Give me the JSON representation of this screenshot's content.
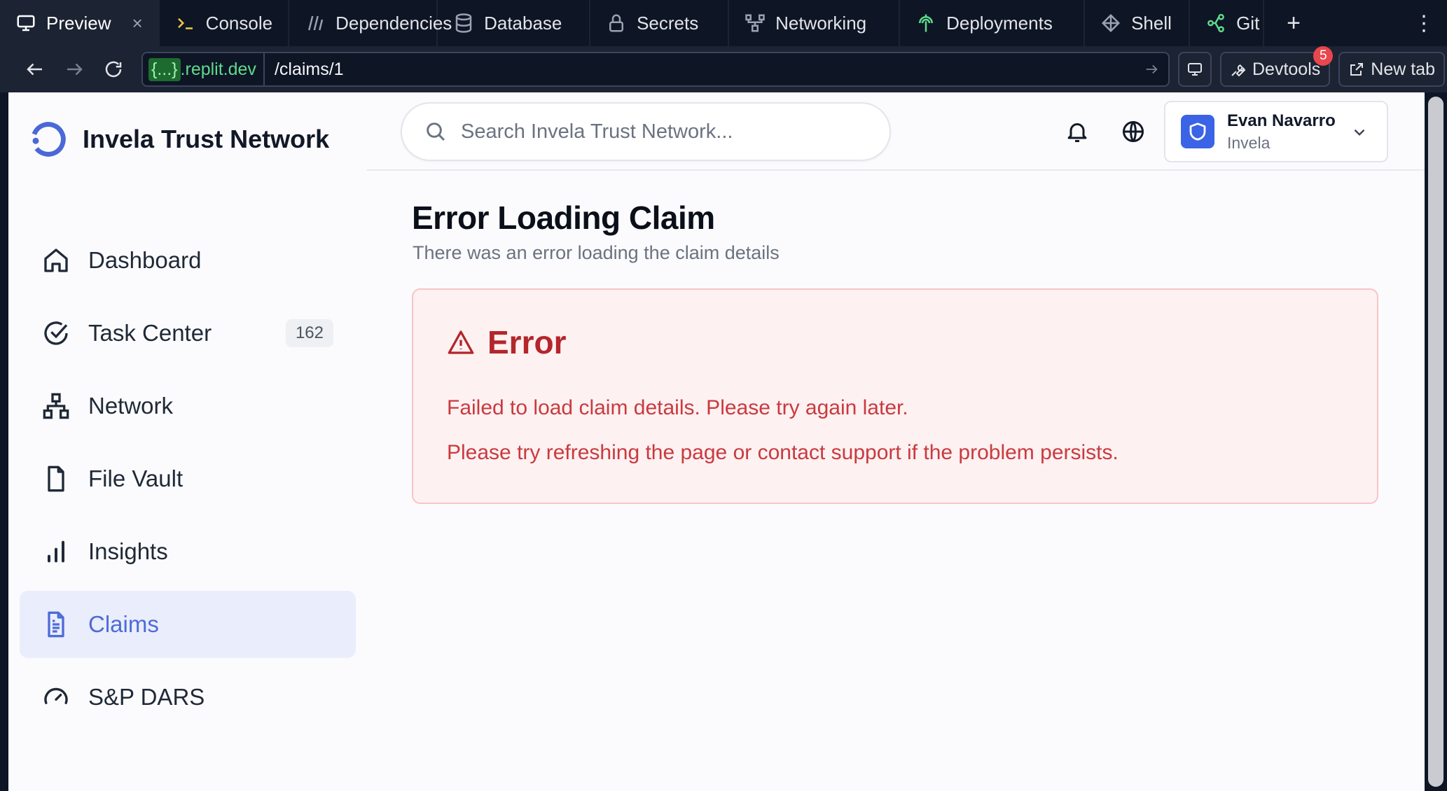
{
  "tabs": [
    {
      "label": "Preview",
      "icon": "monitor-icon",
      "active": true,
      "close": "×"
    },
    {
      "label": "Console",
      "icon": "terminal-icon"
    },
    {
      "label": "Dependencies",
      "icon": "dependencies-icon"
    },
    {
      "label": "Database",
      "icon": "database-icon"
    },
    {
      "label": "Secrets",
      "icon": "lock-icon"
    },
    {
      "label": "Networking",
      "icon": "networking-icon"
    },
    {
      "label": "Deployments",
      "icon": "deployments-icon"
    },
    {
      "label": "Shell",
      "icon": "shell-icon"
    },
    {
      "label": "Git",
      "icon": "git-icon"
    }
  ],
  "tab_actions": {
    "add": "+",
    "more": "⋮"
  },
  "addressbar": {
    "domain_brace": "{...}",
    "domain_suffix": ".replit.dev",
    "path": "/claims/1",
    "devtools_label": "Devtools",
    "devtools_badge": "5",
    "newtab_label": "New tab"
  },
  "sidebar": {
    "brand": "Invela Trust Network",
    "items": [
      {
        "label": "Dashboard",
        "icon": "home-icon"
      },
      {
        "label": "Task Center",
        "icon": "check-circle-icon",
        "count": "162"
      },
      {
        "label": "Network",
        "icon": "network-icon"
      },
      {
        "label": "File Vault",
        "icon": "file-icon"
      },
      {
        "label": "Insights",
        "icon": "bar-chart-icon"
      },
      {
        "label": "Claims",
        "icon": "document-icon",
        "active": true
      },
      {
        "label": "S&P DARS",
        "icon": "gauge-icon"
      }
    ]
  },
  "header": {
    "search_placeholder": "Search Invela Trust Network...",
    "user_name": "Evan Navarro",
    "user_org": "Invela"
  },
  "main": {
    "title": "Error Loading Claim",
    "subtitle": "There was an error loading the claim details",
    "error_title": "Error",
    "error_message": "Failed to load claim details. Please try again later.",
    "error_hint": "Please try refreshing the page or contact support if the problem persists."
  },
  "colors": {
    "accent": "#4e6cd8",
    "error": "#b3262b",
    "error_bg": "#fdf1f1",
    "ide_bg": "#0e1525"
  }
}
